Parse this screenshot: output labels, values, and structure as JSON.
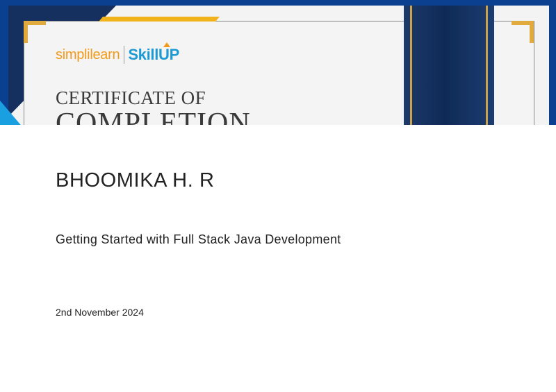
{
  "certificate": {
    "logo_brand": "simpli",
    "logo_brand_2": "learn",
    "logo_product": "SkillUP",
    "title_line1": "CERTIFICATE OF",
    "title_line2": "COMPLETION"
  },
  "recipient": {
    "name": "BHOOMIKA H. R"
  },
  "course": {
    "title": "Getting Started with Full Stack Java Development"
  },
  "issue": {
    "date": "2nd November 2024"
  },
  "colors": {
    "frame_blue": "#0b3f8f",
    "navy": "#15305f",
    "gold": "#e0aa3e",
    "sky": "#1aa0e0",
    "orange": "#f29b1b",
    "skillup_blue": "#1c9ad6"
  }
}
